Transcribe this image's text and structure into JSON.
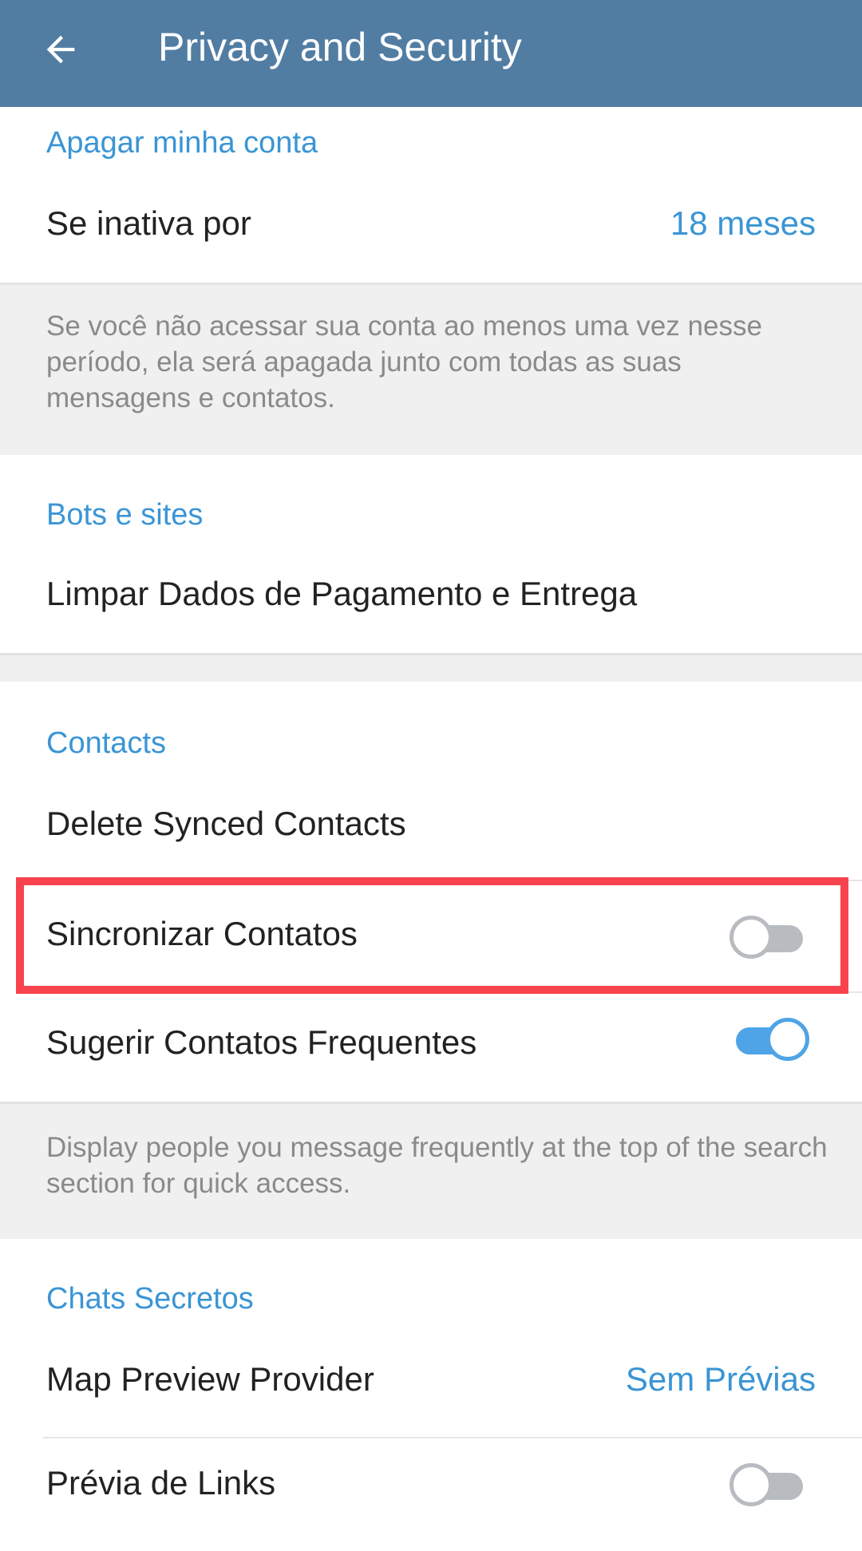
{
  "header": {
    "title": "Privacy and Security",
    "back_icon": "arrow-left-icon"
  },
  "delete_account": {
    "section_title": "Apagar minha conta",
    "row_label": "Se inativa por",
    "row_value": "18 meses",
    "info": "Se você não acessar sua conta ao menos uma vez nesse período, ela será apagada junto com todas as suas mensagens e contatos."
  },
  "bots": {
    "section_title": "Bots e sites",
    "row_label": "Limpar Dados de Pagamento e Entrega"
  },
  "contacts": {
    "section_title": "Contacts",
    "delete_synced": "Delete Synced Contacts",
    "sync_label": "Sincronizar Contatos",
    "sync_enabled": false,
    "suggest_label": "Sugerir Contatos Frequentes",
    "suggest_enabled": true,
    "info": "Display people you message frequently at the top of the search section for quick access."
  },
  "secret_chats": {
    "section_title": "Chats Secretos",
    "map_label": "Map Preview Provider",
    "map_value": "Sem Prévias",
    "links_label": "Prévia de Links",
    "links_enabled": false
  },
  "colors": {
    "header": "#527da3",
    "accent": "#3a95d5",
    "highlight": "#f8434e",
    "toggle_on": "#4ea4e6",
    "toggle_off": "#b8bcc0"
  }
}
